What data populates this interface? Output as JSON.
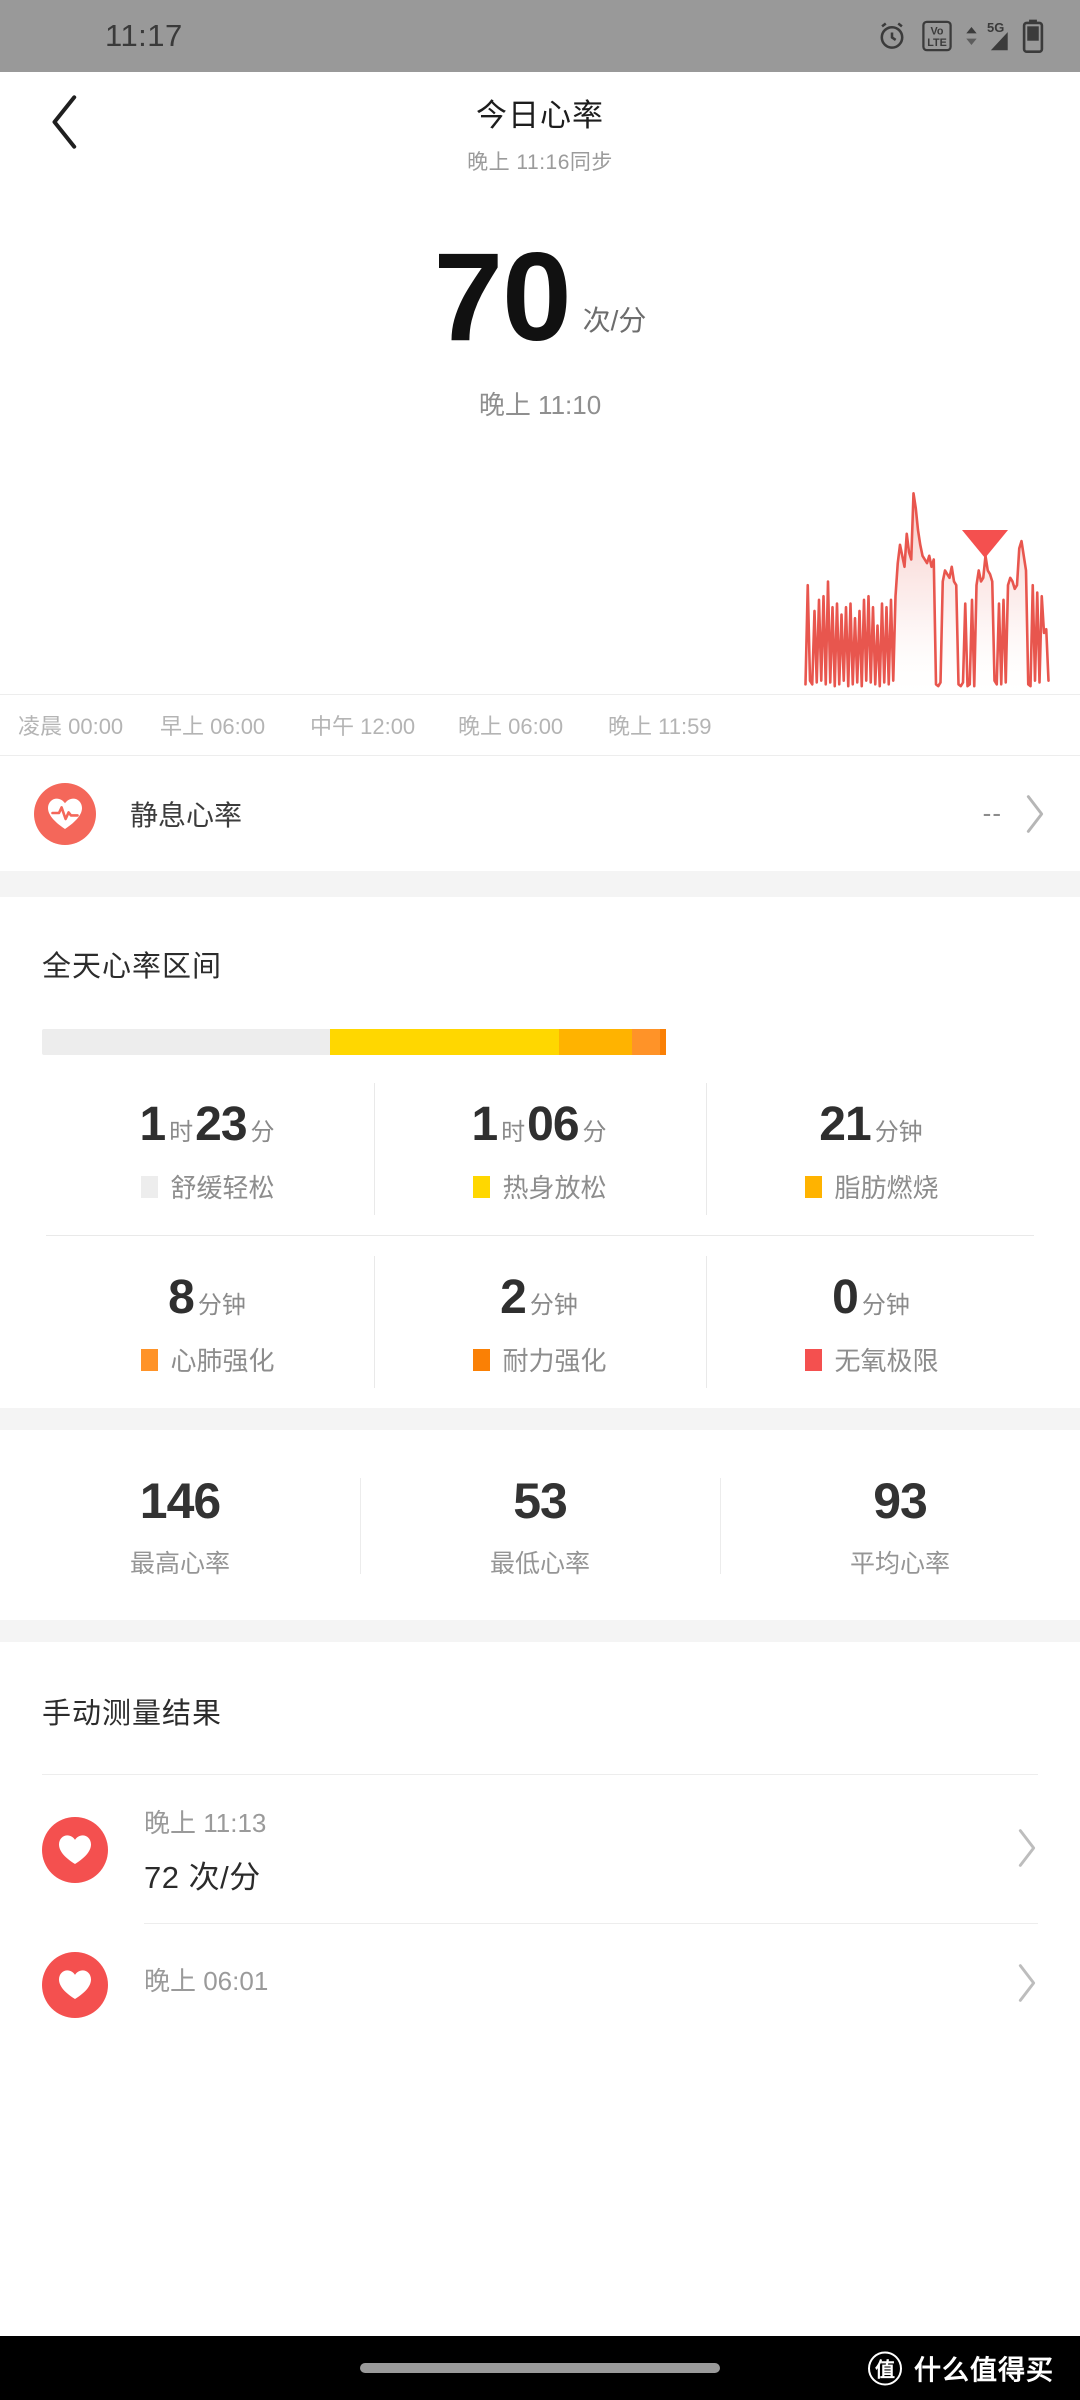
{
  "status_bar": {
    "time": "11:17",
    "icons": [
      "alarm-icon",
      "volte-icon",
      "signal-5g-icon",
      "battery-icon"
    ],
    "volte_top": "Vo",
    "volte_bottom": "LTE",
    "network": "5G"
  },
  "app_bar": {
    "back": "‹",
    "title": "今日心率",
    "subtitle": "晚上 11:16同步"
  },
  "hero": {
    "value": "70",
    "unit": "次/分",
    "time": "晚上 11:10"
  },
  "chart_data": {
    "type": "area",
    "title": "今日心率",
    "xlabel": "",
    "ylabel": "次/分",
    "ylim": [
      40,
      150
    ],
    "grid": false,
    "legend": "none",
    "line_color": "#e8564e",
    "fill_color": "#f9d9d6",
    "marker": {
      "name": "current-value-marker",
      "shape": "triangle-down",
      "color": "#f4504f",
      "x_label": "晚上 11:10"
    },
    "x_ticks": [
      "凌晨 00:00",
      "早上 06:00",
      "中午 12:00",
      "晚上 06:00",
      "晚上 11:59"
    ],
    "x_tick_hours": [
      0,
      6,
      12,
      18,
      23.98
    ],
    "series": [
      {
        "name": "心率",
        "x_hours": [
          17.9,
          17.95,
          18.0,
          18.05,
          18.1,
          18.15,
          18.2,
          18.25,
          18.3,
          18.35,
          18.4,
          18.45,
          18.5,
          18.55,
          18.6,
          18.65,
          18.7,
          18.75,
          18.8,
          18.85,
          18.9,
          18.95,
          19.0,
          19.05,
          19.1,
          19.15,
          19.2,
          19.25,
          19.3,
          19.35,
          19.4,
          19.45,
          19.5,
          19.55,
          19.6,
          19.65,
          19.7,
          19.75,
          19.8,
          19.85,
          19.9,
          19.95,
          20.0,
          20.05,
          20.1,
          20.15,
          20.2,
          20.25,
          20.3,
          20.35,
          20.4,
          20.45,
          20.5,
          20.55,
          20.6,
          20.65,
          20.7,
          20.75,
          20.8,
          20.85,
          20.9,
          20.95,
          21.0,
          21.05,
          21.1,
          21.15,
          21.2,
          21.25,
          21.3,
          21.35,
          21.4,
          21.45,
          21.5,
          21.55,
          21.6,
          21.65,
          21.7,
          21.75,
          21.8,
          21.85,
          21.9,
          21.95,
          22.0,
          22.05,
          22.1,
          22.15,
          22.2,
          22.25,
          22.3,
          22.35,
          22.4,
          22.45,
          22.5,
          22.55,
          22.6,
          22.65,
          22.7,
          22.75,
          22.8,
          22.85,
          22.9,
          22.95,
          23.0,
          23.05,
          23.1,
          23.15,
          23.2,
          23.25,
          23.3
        ],
        "values": [
          42,
          96,
          44,
          42,
          82,
          43,
          88,
          44,
          90,
          42,
          98,
          43,
          84,
          41,
          86,
          42,
          80,
          44,
          84,
          41,
          86,
          42,
          78,
          43,
          82,
          41,
          88,
          44,
          90,
          43,
          84,
          42,
          74,
          41,
          86,
          43,
          84,
          42,
          88,
          44,
          90,
          108,
          118,
          112,
          106,
          124,
          114,
          110,
          146,
          138,
          126,
          118,
          112,
          110,
          108,
          112,
          106,
          110,
          42,
          41,
          43,
          98,
          104,
          102,
          100,
          106,
          98,
          96,
          42,
          41,
          43,
          86,
          41,
          42,
          88,
          41,
          96,
          104,
          98,
          100,
          112,
          104,
          102,
          98,
          44,
          42,
          86,
          42,
          88,
          43,
          96,
          100,
          98,
          94,
          96,
          116,
          120,
          112,
          104,
          42,
          41,
          96,
          44,
          92,
          43,
          90,
          70,
          72,
          44
        ]
      }
    ]
  },
  "resting_row": {
    "icon": "heart-pulse-icon",
    "label": "静息心率",
    "value": "--",
    "chevron": "›"
  },
  "zones": {
    "title": "全天心率区间",
    "bar_segments": [
      {
        "name": "舒缓轻松",
        "color": "#ededed",
        "percent": 28.9
      },
      {
        "name": "热身放松",
        "color": "#ffd700",
        "percent": 23.0
      },
      {
        "name": "脂肪燃烧",
        "color": "#ffb300",
        "percent": 7.3
      },
      {
        "name": "心肺强化",
        "color": "#ff9328",
        "percent": 2.8
      },
      {
        "name": "耐力强化",
        "color": "#fa8005",
        "percent": 0.7
      },
      {
        "name": "无氧极限",
        "color": "#f4504f",
        "percent": 0.0
      }
    ],
    "items": [
      {
        "hours": "1",
        "hours_unit": "时",
        "minutes": "23",
        "minutes_unit": "分",
        "name": "舒缓轻松",
        "color": "#ededed"
      },
      {
        "hours": "1",
        "hours_unit": "时",
        "minutes": "06",
        "minutes_unit": "分",
        "name": "热身放松",
        "color": "#ffd700"
      },
      {
        "hours": "",
        "hours_unit": "",
        "minutes": "21",
        "minutes_unit": "分钟",
        "name": "脂肪燃烧",
        "color": "#ffb300"
      },
      {
        "hours": "",
        "hours_unit": "",
        "minutes": "8",
        "minutes_unit": "分钟",
        "name": "心肺强化",
        "color": "#ff9328"
      },
      {
        "hours": "",
        "hours_unit": "",
        "minutes": "2",
        "minutes_unit": "分钟",
        "name": "耐力强化",
        "color": "#fa8005"
      },
      {
        "hours": "",
        "hours_unit": "",
        "minutes": "0",
        "minutes_unit": "分钟",
        "name": "无氧极限",
        "color": "#f4504f"
      }
    ]
  },
  "summary": [
    {
      "value": "146",
      "label": "最高心率"
    },
    {
      "value": "53",
      "label": "最低心率"
    },
    {
      "value": "93",
      "label": "平均心率"
    }
  ],
  "manual": {
    "title": "手动测量结果",
    "items": [
      {
        "icon": "heart-icon",
        "time": "晚上 11:13",
        "bpm": "72 次/分",
        "chevron": "›"
      },
      {
        "icon": "heart-icon",
        "time": "晚上 06:01",
        "bpm": "",
        "chevron": "›"
      }
    ]
  },
  "nav_bar": {
    "watermark_logo": "值",
    "watermark_text": "什么值得买"
  }
}
